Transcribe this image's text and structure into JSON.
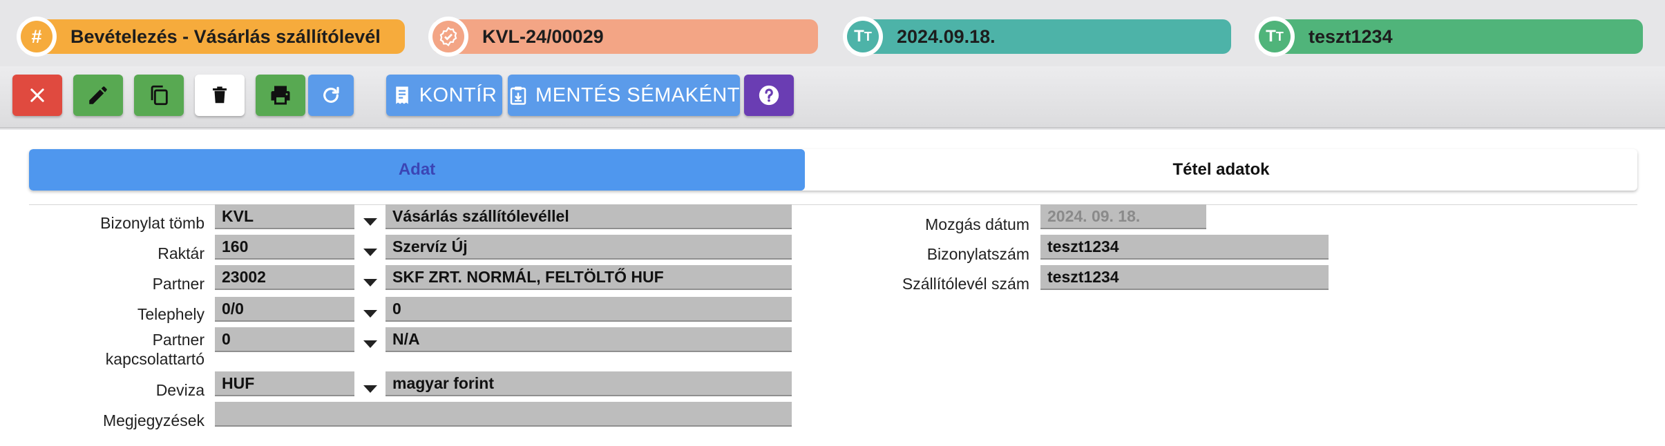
{
  "header": {
    "chips": [
      {
        "icon": "hash-icon",
        "text": "Bevételezés - Vásárlás szállítólevél",
        "color": "#f6ab3c",
        "icon_color": "#f6ab3c"
      },
      {
        "icon": "badge-check-icon",
        "text": "KVL-24/00029",
        "color": "#f3a585",
        "icon_color": "#f3a585"
      },
      {
        "icon": "text-type-icon",
        "text": "2024.09.18.",
        "color": "#4db3a8",
        "icon_color": "#4db3a8"
      },
      {
        "icon": "text-type-icon",
        "text": "teszt1234",
        "color": "#50b47a",
        "icon_color": "#50b47a"
      }
    ]
  },
  "toolbar": {
    "buttons": [
      {
        "name": "close",
        "icon": "close-icon",
        "color": "#e04a3f"
      },
      {
        "name": "edit",
        "icon": "pencil-icon",
        "color": "#58a952"
      },
      {
        "name": "copy",
        "icon": "copy-icon",
        "color": "#58a952"
      },
      {
        "name": "delete",
        "icon": "trash-icon",
        "color": "#ffffff"
      },
      {
        "name": "print",
        "icon": "printer-icon",
        "color": "#58a952"
      },
      {
        "name": "refresh",
        "icon": "refresh-icon",
        "color": "#5b9bea"
      }
    ],
    "kontir_label": "KONTÍR",
    "save_schema_label": "MENTÉS SÉMAKÉNT",
    "help_icon": "help-icon"
  },
  "tabs": {
    "data_label": "Adat",
    "items_label": "Tétel adatok",
    "active": "Adat"
  },
  "form": {
    "left": [
      {
        "label": "Bizonylat tömb",
        "code": "KVL",
        "value": "Vásárlás szállítólevéllel"
      },
      {
        "label": "Raktár",
        "code": "160",
        "value": "Szervíz Új"
      },
      {
        "label": "Partner",
        "code": "23002",
        "value": "SKF ZRT. NORMÁL, FELTÖLTŐ HUF"
      },
      {
        "label": "Telephely",
        "code": "0/0",
        "value": "0"
      },
      {
        "label_line1": "Partner",
        "label_line2": "kapcsolattartó",
        "code": "0",
        "value": "N/A"
      },
      {
        "label": "Deviza",
        "code": "HUF",
        "value": "magyar forint"
      },
      {
        "label": "Megjegyzések",
        "value": ""
      }
    ],
    "right": [
      {
        "label": "Mozgás dátum",
        "value": "2024. 09. 18."
      },
      {
        "label": "Bizonylatszám",
        "value": "teszt1234"
      },
      {
        "label": "Szállítólevél szám",
        "value": "teszt1234"
      }
    ]
  }
}
